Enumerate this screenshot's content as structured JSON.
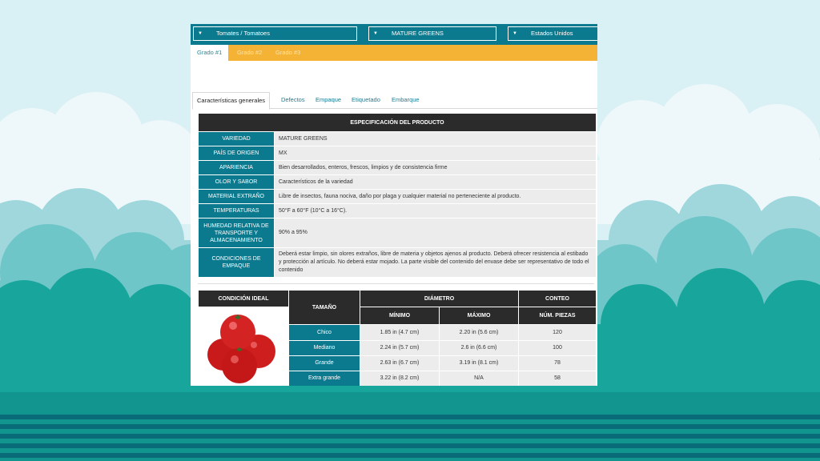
{
  "topbar": {
    "product": "Tomates / Tomatoes",
    "variety": "MATURE GREENS",
    "country": "Estados Unidos"
  },
  "grades": [
    "Grado #1",
    "Grado #2",
    "Grado #3"
  ],
  "tabs": [
    "Características generales",
    "Defectos",
    "Empaque",
    "Etiquetado",
    "Embarque"
  ],
  "spec": {
    "title": "ESPECIFICACIÓN DEL PRODUCTO",
    "rows": [
      {
        "label": "VARIEDAD",
        "value": "MATURE GREENS"
      },
      {
        "label": "PAÍS DE ORIGEN",
        "value": "MX"
      },
      {
        "label": "APARIENCIA",
        "value": "Bien desarrollados, enteros, frescos, limpios y de consistencia firme"
      },
      {
        "label": "OLOR Y SABOR",
        "value": "Característicos de la variedad"
      },
      {
        "label": "MATERIAL EXTRAÑO",
        "value": "Libre de insectos, fauna nociva, daño por plaga y cualquier material no perteneciente al producto."
      },
      {
        "label": "TEMPERATURAS",
        "value": "50°F a 60°F (10°C a 16°C)."
      },
      {
        "label": "HUMEDAD RELATIVA DE TRANSPORTE Y ALMACENAMIENTO",
        "value": "90% a 95%"
      },
      {
        "label": "CONDICIONES DE EMPAQUE",
        "value": "Deberá estar limpio, sin olores extraños, libre de materia y objetos ajenos al producto. Deberá ofrecer resistencia al estibado y protección al artículo. No deberá estar mojado. La parte visible del contenido del envase debe ser representativo de todo el contenido"
      }
    ]
  },
  "sizes": {
    "ideal": "CONDICIÓN IDEAL",
    "size_h": "TAMAÑO",
    "diam_h": "DIÁMETRO",
    "count_h": "CONTEO",
    "min_h": "MÍNIMO",
    "max_h": "MÁXIMO",
    "pieces_h": "NÚM. PIEZAS",
    "rows": [
      {
        "size": "Chico",
        "min": "1.85 in (4.7 cm)",
        "max": "2.20 in (5.6 cm)",
        "count": "120"
      },
      {
        "size": "Mediano",
        "min": "2.24 in (5.7 cm)",
        "max": "2.6 in (6.6 cm)",
        "count": "100"
      },
      {
        "size": "Grande",
        "min": "2.63 in (6.7 cm)",
        "max": "3.19 in (8.1 cm)",
        "count": "78"
      },
      {
        "size": "Extra grande",
        "min": "3.22 in (8.2 cm)",
        "max": "N/A",
        "count": "58"
      }
    ]
  }
}
